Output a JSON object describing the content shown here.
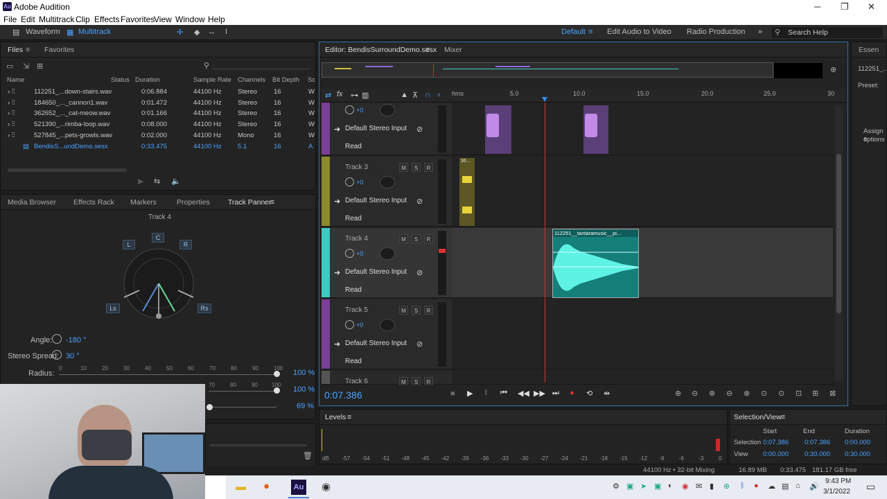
{
  "window": {
    "title": "Adobe Audition",
    "logo": "Au",
    "minimize_icon": "─",
    "maximize_icon": "❐",
    "close_icon": "✕"
  },
  "menu": [
    "File",
    "Edit",
    "Multitrack",
    "Clip",
    "Effects",
    "Favorites",
    "View",
    "Window",
    "Help"
  ],
  "toolbar": {
    "waveform": "Waveform",
    "multitrack": "Multitrack",
    "workspaces": [
      "Default",
      "Edit Audio to Video",
      "Radio Production"
    ],
    "more": "»",
    "search": "Search Help"
  },
  "files_panel": {
    "tabs": [
      "Files",
      "Favorites"
    ],
    "columns": [
      "Name",
      "Status",
      "Duration",
      "Sample Rate",
      "Channels",
      "Bit Depth",
      "Sc"
    ],
    "rows": [
      {
        "name": "112251_...down-stairs.wav",
        "duration": "0:06.884",
        "rate": "44100 Hz",
        "channels": "Stereo",
        "depth": "16",
        "fmt": "W"
      },
      {
        "name": "184650_..._cannon1.wav",
        "duration": "0:01.472",
        "rate": "44100 Hz",
        "channels": "Stereo",
        "depth": "16",
        "fmt": "W"
      },
      {
        "name": "362652_..._cat-meow.wav",
        "duration": "0:01.166",
        "rate": "44100 Hz",
        "channels": "Stereo",
        "depth": "16",
        "fmt": "W"
      },
      {
        "name": "521390_...rimba-loop.wav",
        "duration": "0:08.000",
        "rate": "44100 Hz",
        "channels": "Stereo",
        "depth": "16",
        "fmt": "W"
      },
      {
        "name": "527845_...pets-growls.wav",
        "duration": "0:02.000",
        "rate": "44100 Hz",
        "channels": "Mono",
        "depth": "16",
        "fmt": "W"
      },
      {
        "name": "BendisS...undDemo.sesx",
        "duration": "0:33.475",
        "rate": "44100 Hz",
        "channels": "5.1",
        "depth": "16",
        "fmt": "A"
      }
    ]
  },
  "lower_tabs": [
    "Media Browser",
    "Effects Rack",
    "Markers",
    "Properties",
    "Track Panner"
  ],
  "panner": {
    "track": "Track 4",
    "speakers": {
      "L": "L",
      "C": "C",
      "R": "R",
      "Ls": "Ls",
      "Rs": "Rs"
    },
    "angle_label": "Angle:",
    "angle_value": "-180 °",
    "spread_label": "Stereo Spread:",
    "spread_value": "30 °",
    "radius_label": "Radius:",
    "scale": [
      "0",
      "10",
      "20",
      "30",
      "40",
      "50",
      "60",
      "70",
      "80",
      "90",
      "100"
    ],
    "pcts": [
      "100 %",
      "100 %",
      "69 %"
    ],
    "scale2_tail": [
      "70",
      "80",
      "90",
      "100"
    ]
  },
  "editor": {
    "tab": "Editor: BendisSurroundDemo.sesx",
    "mixer": "Mixer",
    "ruler": [
      "hms",
      "5.0",
      "10.0",
      "15.0",
      "20.0",
      "25.0",
      "30"
    ],
    "tracks": [
      {
        "name": "",
        "input": "Default Stereo Input",
        "mode": "Read",
        "vol": "+0"
      },
      {
        "name": "Track 3",
        "input": "Default Stereo Input",
        "mode": "Read",
        "vol": "+0"
      },
      {
        "name": "Track 4",
        "input": "Default Stereo Input",
        "mode": "Read",
        "vol": "+0"
      },
      {
        "name": "Track 5",
        "input": "Default Stereo Input",
        "mode": "Read",
        "vol": "+0"
      },
      {
        "name": "Track 6"
      }
    ],
    "msr": [
      "M",
      "S",
      "R"
    ],
    "clip_label": "112251__tantaramusic__pi...",
    "clip3_label": "36...",
    "time": "0:07.386"
  },
  "right_panel": {
    "tab": "Essen",
    "file": "112251_...",
    "preset": "Preset:",
    "hint": "Assign a",
    "hint2": "options"
  },
  "levels": {
    "title": "Levels",
    "scale": [
      "dB",
      "-57",
      "-54",
      "-51",
      "-48",
      "-45",
      "-42",
      "-39",
      "-36",
      "-33",
      "-30",
      "-27",
      "-24",
      "-21",
      "-18",
      "-15",
      "-12",
      "-9",
      "-6",
      "-3",
      "0"
    ]
  },
  "selection": {
    "title": "Selection/View",
    "headers": [
      "Start",
      "End",
      "Duration"
    ],
    "selection": {
      "label": "Selection",
      "start": "0:07.386",
      "end": "0:07.386",
      "duration": "0:00.000"
    },
    "view": {
      "label": "View",
      "start": "0:00.000",
      "end": "0:30.000",
      "duration": "0:30.000"
    }
  },
  "status": {
    "format": "44100 Hz • 32-bit Mixing",
    "mem": "16.89 MB",
    "dur": "0:33.475",
    "free": "181.17 GB free"
  },
  "taskbar": {
    "time": "9:43 PM",
    "date": "3/1/2022",
    "au": "Au"
  }
}
